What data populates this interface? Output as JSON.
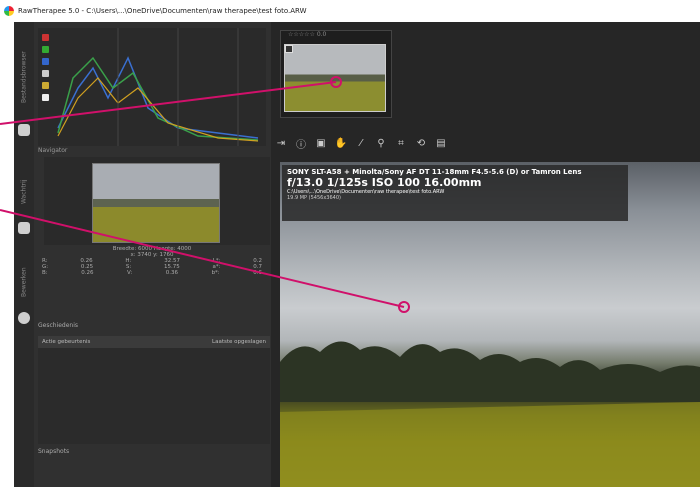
{
  "window": {
    "title": "RawTherapee 5.0 - C:\\Users\\...\\OneDrive\\Documenten\\raw therapee\\test foto.ARW"
  },
  "side_tabs": [
    "Bestandsbrowser",
    "Wachtrij",
    "Bewerken"
  ],
  "navigator": {
    "label": "Navigator",
    "dims_text": "Breedte: 6000 Hoogte: 4000",
    "coords_text": "x: 3740 y: 1760",
    "rows": [
      [
        "R:",
        "0.26",
        "H:",
        "32.57",
        "L*:",
        "0.2"
      ],
      [
        "G:",
        "0.25",
        "S:",
        "15.75",
        "a*:",
        "0.7"
      ],
      [
        "B:",
        "0.26",
        "V:",
        "0.36",
        "b*:",
        "0.6"
      ]
    ]
  },
  "queue": {
    "label": "Geschiedenis",
    "col1": "Actie gebeurtenis",
    "col2": "Laatste opgeslagen"
  },
  "history_label": "Snapshots",
  "filmstrip": {
    "label": "☆☆☆☆☆",
    "rank": "0.0"
  },
  "toolbar": [
    "⇥",
    "ⓘ",
    "▣",
    "✋",
    "⁄",
    "⚲",
    "⌗",
    "⟲",
    "▤"
  ],
  "info": {
    "line1": "SONY SLT-A58 + Minolta/Sony AF DT 11-18mm F4.5-5.6 (D) or Tamron Lens",
    "line2": "f/13.0  1/125s  ISO 100  16.00mm",
    "line3": "C:\\Users\\...\\OneDrive\\Documenten\\raw therapee\\test foto.ARW",
    "line4": "19.9 MP (5456x3640)"
  },
  "colors": {
    "accent_pink": "#d0106a",
    "panel": "#303030"
  }
}
